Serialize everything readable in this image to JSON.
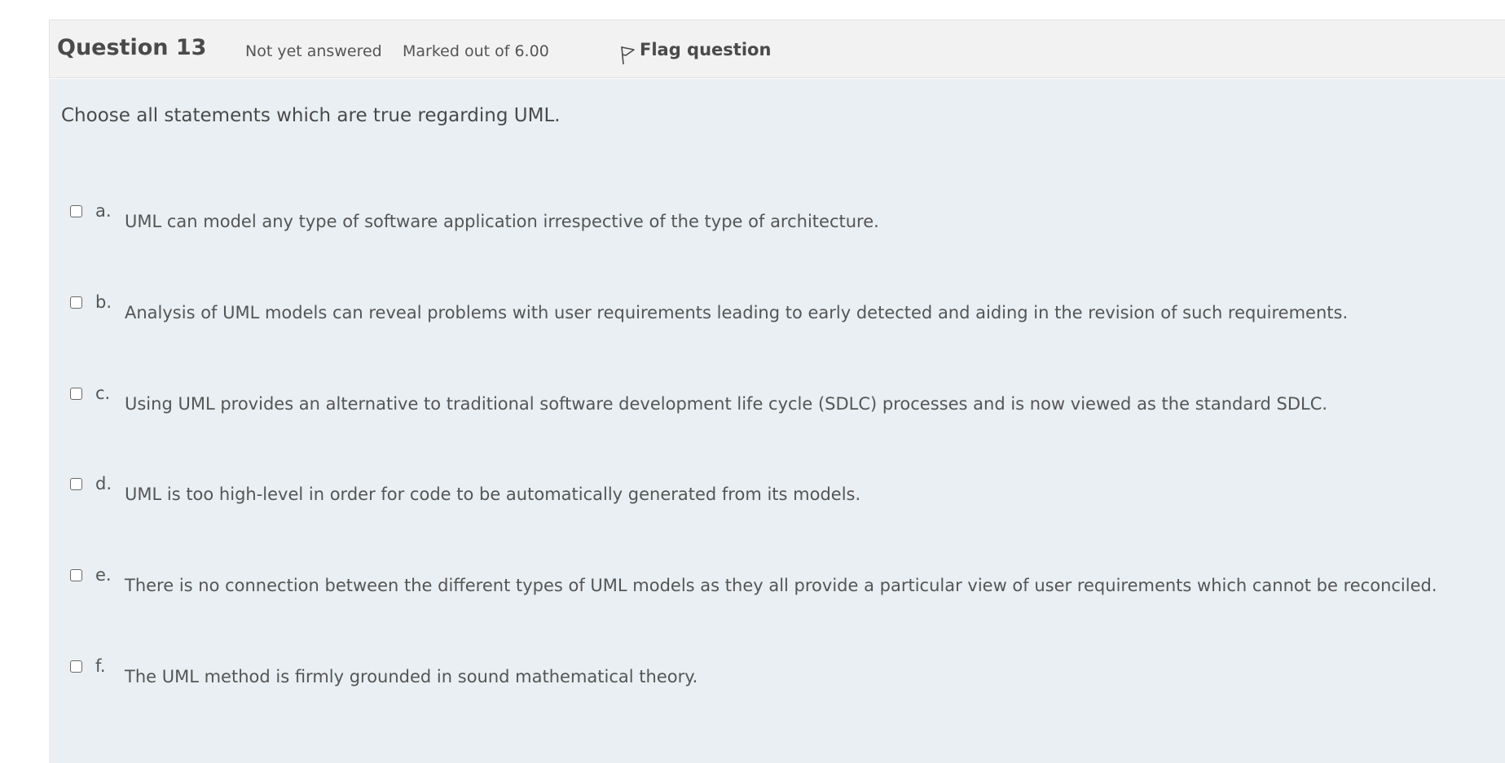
{
  "question": {
    "number_label": "Question 13",
    "state": "Not yet answered",
    "grade": "Marked out of 6.00",
    "flag_label": "Flag question",
    "flag_icon": "flag-icon",
    "text": "Choose all statements which are true regarding UML."
  },
  "answers": [
    {
      "letter": "a.",
      "text": "UML can model any type of software application irrespective of the type of architecture.",
      "checked": false
    },
    {
      "letter": "b.",
      "text": "Analysis of UML models can reveal problems with user requirements leading to early detected and aiding in the revision of such requirements.",
      "checked": false
    },
    {
      "letter": "c.",
      "text": "Using UML provides an alternative to traditional software development life cycle (SDLC) processes and is now viewed as the standard SDLC.",
      "checked": false
    },
    {
      "letter": "d.",
      "text": "UML is too high-level in order for code to be automatically generated from its models.",
      "checked": false
    },
    {
      "letter": "e.",
      "text": "There is no connection between the different types of UML models as they all provide a particular view of user requirements which cannot be reconciled.",
      "checked": false
    },
    {
      "letter": "f.",
      "text": "The UML method is firmly grounded in sound mathematical theory.",
      "checked": false
    }
  ],
  "colors": {
    "header_bg": "#f2f2f2",
    "content_bg": "#e9eff2",
    "text": "#4a4a4a"
  }
}
